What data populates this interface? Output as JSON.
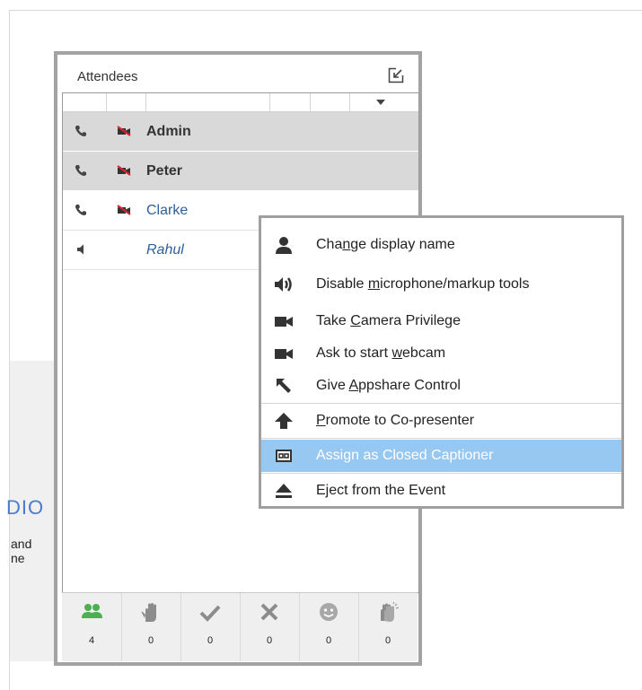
{
  "background": {
    "audio_text": "DIO",
    "line1": "and",
    "line2": "ne"
  },
  "panel": {
    "title": "Attendees",
    "attendees": [
      {
        "name": "Admin",
        "style": "selected",
        "audio": "phone",
        "camera": "off"
      },
      {
        "name": "Peter",
        "style": "selected",
        "audio": "phone",
        "camera": "off"
      },
      {
        "name": "Clarke",
        "style": "link",
        "audio": "phone",
        "camera": "off"
      },
      {
        "name": "Rahul",
        "style": "italic",
        "audio": "speaker",
        "camera": "none"
      }
    ],
    "footer": [
      {
        "icon": "people-icon",
        "count": "4"
      },
      {
        "icon": "raise-hand-icon",
        "count": "0"
      },
      {
        "icon": "checkmark-icon",
        "count": "0"
      },
      {
        "icon": "x-icon",
        "count": "0"
      },
      {
        "icon": "smiley-icon",
        "count": "0"
      },
      {
        "icon": "applause-icon",
        "count": "0"
      }
    ]
  },
  "context_menu": {
    "items": [
      {
        "pre": "Cha",
        "u": "n",
        "post": "ge display name",
        "icon": "person-icon"
      },
      {
        "pre": "Disable ",
        "u": "m",
        "post": "icrophone/markup tools",
        "icon": "speaker-icon"
      },
      {
        "pre": "Take ",
        "u": "C",
        "post": "amera Privilege",
        "icon": "camera-icon"
      },
      {
        "pre": "Ask to start ",
        "u": "w",
        "post": "ebcam",
        "icon": "camera-icon"
      },
      {
        "pre": "Give ",
        "u": "A",
        "post": "ppshare Control",
        "icon": "pointer-arrow-icon"
      },
      {
        "pre": "",
        "u": "P",
        "post": "romote to Co-presenter",
        "icon": "up-arrow-icon"
      },
      {
        "pre": "Assign as Closed Captioner",
        "u": "",
        "post": "",
        "icon": "closed-caption-icon",
        "highlighted": true
      },
      {
        "pre": "E",
        "u": "j",
        "post": "ect from the Event",
        "icon": "eject-icon"
      }
    ]
  },
  "colors": {
    "highlight": "#97c8f1",
    "selected_row": "#d9d9d9",
    "camera_off_red": "#d9262c",
    "green_icon": "#4caf50",
    "link_blue": "#2e5f9b"
  }
}
